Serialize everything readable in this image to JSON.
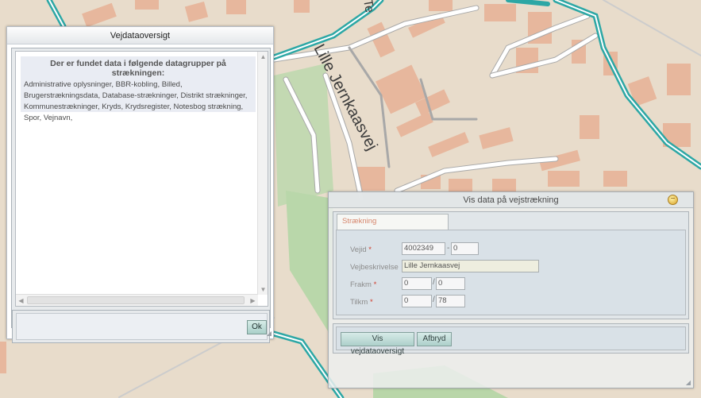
{
  "map": {
    "street_label_main": "Lille Jernkaasvej",
    "street_label_top": "Te",
    "colors": {
      "background": "#e8dccb",
      "road_outline": "#2ca7a5",
      "road_fill": "#ffffff",
      "building": "#e7b79d",
      "green": "#b7d6a6"
    }
  },
  "vejdataoversigt": {
    "title": "Vejdataoversigt",
    "heading": "Der er fundet data i følgende datagrupper på strækningen:",
    "body": "Administrative oplysninger, BBR-kobling, Billed, Brugerstrækningsdata, Database-strækninger, Distrikt strækninger, Kommunestrækninger, Kryds, Krydsregister, Notesbog strækning, Spor, Vejnavn,",
    "ok_label": "Ok",
    "icons": {
      "scroll_up": "▲",
      "scroll_down": "▼",
      "scroll_left": "◀",
      "scroll_right": "▶",
      "resize": "◢"
    }
  },
  "vis_data": {
    "title": "Vis data på vejstrækning",
    "close_icon": "−",
    "tab_label": "Strækning",
    "fields": {
      "vejid_label": "Vejid",
      "vejid_value": "4002349",
      "vejid_sep": "-",
      "vejid_sub_value": "0",
      "vejbeskrivelse_label": "Vejbeskrivelse",
      "vejbeskrivelse_value": "Lille Jernkaasvej",
      "frakm_label": "Frakm",
      "frakm_km": "0",
      "frakm_sep": "/",
      "frakm_m": "0",
      "tilkm_label": "Tilkm",
      "tilkm_km": "0",
      "tilkm_sep": "/",
      "tilkm_m": "78",
      "required_marker": "*"
    },
    "buttons": {
      "vis_label": "Vis vejdataoversigt",
      "afbryd_label": "Afbryd"
    },
    "resize_icon": "◢"
  }
}
